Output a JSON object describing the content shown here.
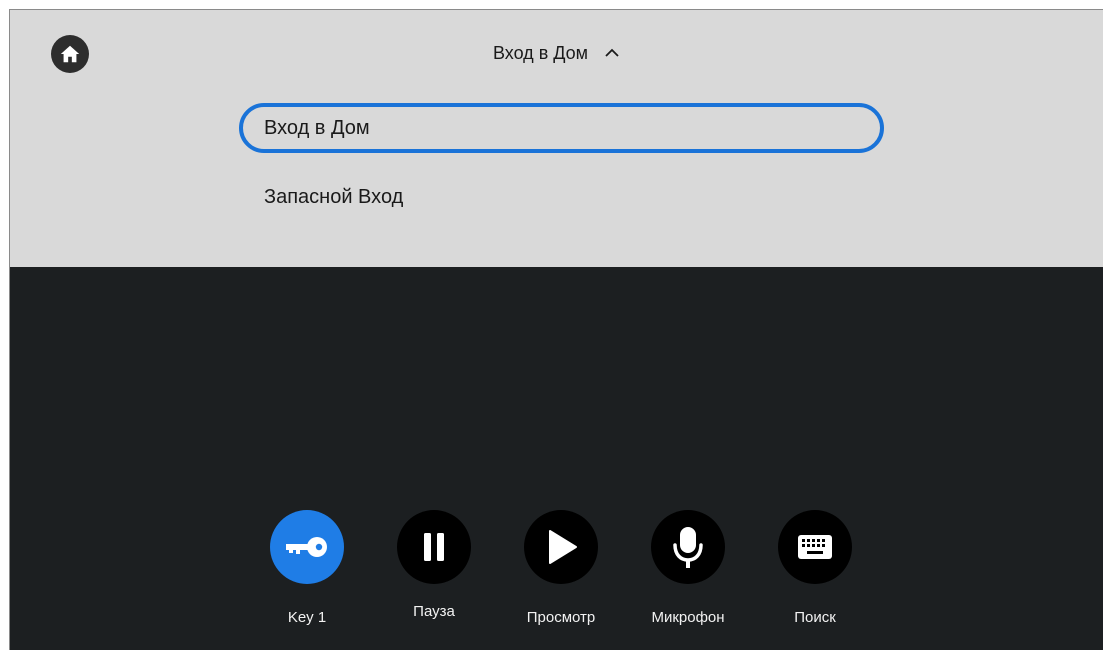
{
  "header": {
    "home_icon": "home-icon",
    "dropdown_title": "Вход в Дом",
    "chevron_icon": "chevron-up-icon"
  },
  "dropdown": {
    "options": [
      {
        "label": "Вход в Дом",
        "selected": true
      },
      {
        "label": "Запасной Вход",
        "selected": false
      }
    ]
  },
  "controls": [
    {
      "label": "Key 1",
      "icon": "key-icon",
      "active": true
    },
    {
      "label": "Пауза",
      "icon": "pause-icon",
      "active": false
    },
    {
      "label": "Просмотр",
      "icon": "play-icon",
      "active": false
    },
    {
      "label": "Микрофон",
      "icon": "microphone-icon",
      "active": false
    },
    {
      "label": "Поиск",
      "icon": "keyboard-icon",
      "active": false
    }
  ],
  "colors": {
    "top_panel": "#d9d9d9",
    "video_area": "#1c1f21",
    "accent": "#1f7de6",
    "selection_border": "#1a73d8"
  }
}
